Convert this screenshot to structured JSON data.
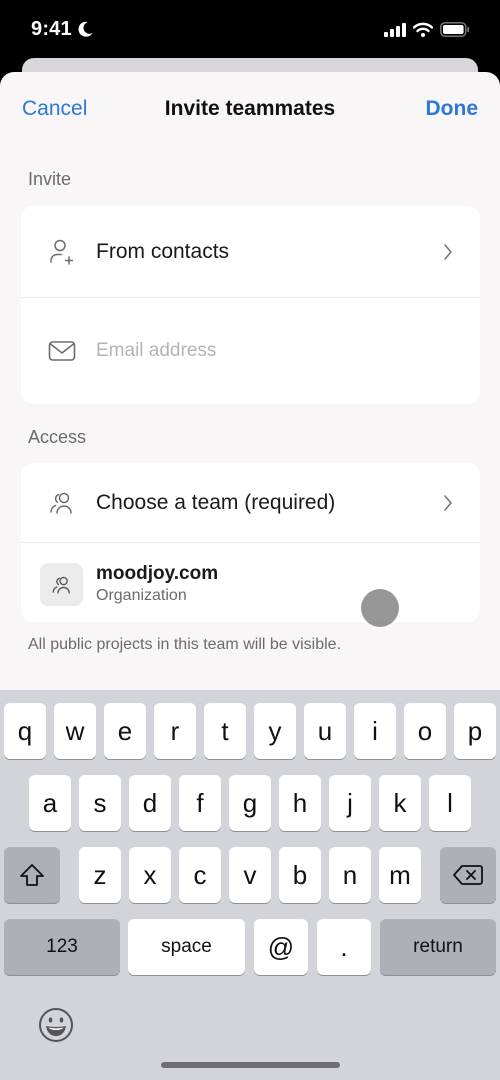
{
  "status_bar": {
    "time": "9:41",
    "icons": [
      "moon-icon",
      "cellular-signal-icon",
      "wifi-icon",
      "battery-icon"
    ]
  },
  "nav": {
    "cancel_label": "Cancel",
    "title": "Invite teammates",
    "done_label": "Done"
  },
  "invite_section": {
    "label": "Invite",
    "from_contacts_label": "From contacts",
    "email_placeholder": "Email address",
    "email_value": ""
  },
  "access_section": {
    "label": "Access",
    "choose_team_label": "Choose a team (required)",
    "organization": {
      "name": "moodjoy.com",
      "type": "Organization"
    },
    "footnote": "All public projects in this team will be visible."
  },
  "keyboard": {
    "row1": [
      "q",
      "w",
      "e",
      "r",
      "t",
      "y",
      "u",
      "i",
      "o",
      "p"
    ],
    "row2": [
      "a",
      "s",
      "d",
      "f",
      "g",
      "h",
      "j",
      "k",
      "l"
    ],
    "row3": [
      "z",
      "x",
      "c",
      "v",
      "b",
      "n",
      "m"
    ],
    "numbers_label": "123",
    "space_label": "space",
    "at_label": "@",
    "dot_label": ".",
    "return_label": "return"
  },
  "colors": {
    "accent": "#2a7ad6",
    "sheet_background": "#f8f6f7",
    "keyboard_background": "#d3d4d9"
  }
}
